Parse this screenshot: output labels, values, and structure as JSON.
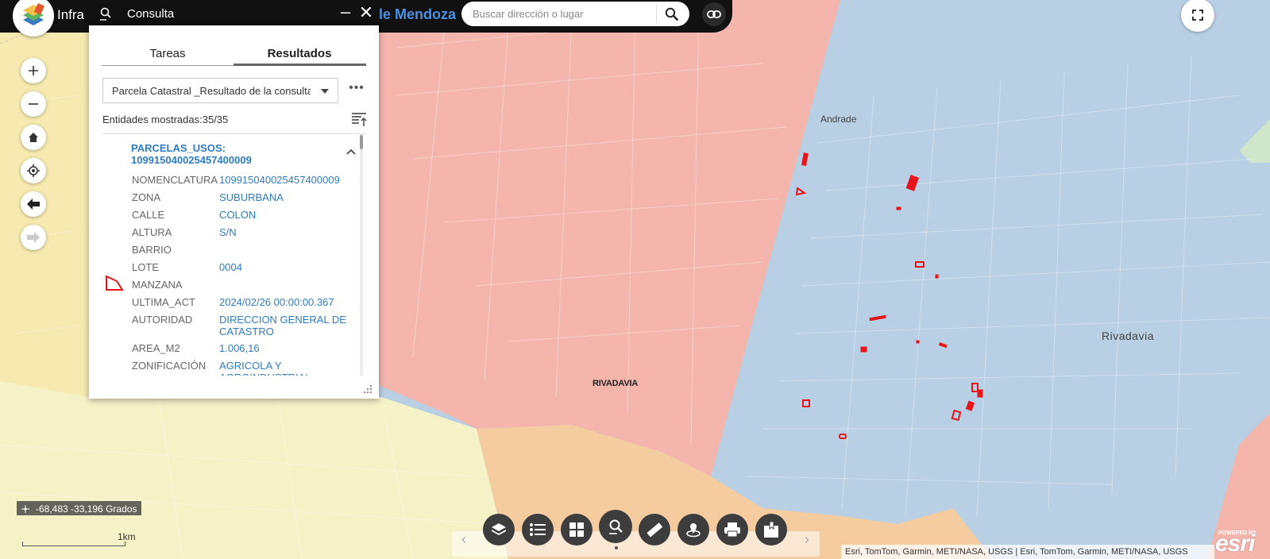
{
  "header": {
    "app_title": "Infra",
    "app_title_right": "le Mendoza",
    "search_placeholder": "Buscar dirección o lugar"
  },
  "panel": {
    "title": "Consulta",
    "tabs": [
      {
        "label": "Tareas",
        "active": false
      },
      {
        "label": "Resultados",
        "active": true
      }
    ],
    "layer_selected": "Parcela Catastral _Resultado de la consulta",
    "count_label": "Entidades mostradas:35/35",
    "result": {
      "title_line1": "PARCELAS_USOS:",
      "title_line2": "109915040025457400009",
      "attributes": [
        {
          "name": "NOMENCLATURA",
          "value": "109915040025457400009"
        },
        {
          "name": "ZONA",
          "value": "SUBURBANA"
        },
        {
          "name": "CALLE",
          "value": "COLON"
        },
        {
          "name": "ALTURA",
          "value": "S/N"
        },
        {
          "name": "BARRIO",
          "value": ""
        },
        {
          "name": "LOTE",
          "value": "0004"
        },
        {
          "name": "MANZANA",
          "value": ""
        },
        {
          "name": "ULTIMA_ACT",
          "value": "2024/02/26 00:00:00.367"
        },
        {
          "name": "AUTORIDAD",
          "value": "DIRECCION GENERAL DE CATASTRO"
        },
        {
          "name": "AREA_M2",
          "value": "1.006,16"
        },
        {
          "name": "ZONIFICACIÓN",
          "value": "AGRICOLA Y AGROINDUSTRIAL"
        }
      ]
    }
  },
  "map": {
    "labels": {
      "andrade": "Andrade",
      "rivadavia_city": "Rivadavia",
      "rivadavia_dept": "RIVADAVIA"
    },
    "coordinates": "-68,483 -33,196 Grados",
    "scale_label": "1km",
    "attribution": "Esri, TomTom, Garmin, METI/NASA, USGS | Esri, TomTom, Garmin, METI/NASA, USGS",
    "esri_logo": "esri",
    "esri_powered": "POWERED BY",
    "colors": {
      "zone_red": "#f4b5ad",
      "zone_blue": "#b8cfe4",
      "zone_yellow": "#f6eab0",
      "zone_cream": "#f5f2c8",
      "zone_orange": "#f5cca0",
      "parcel_red": "#e8141c",
      "link_blue": "#2e7bc4"
    }
  },
  "toolbar": {
    "buttons": [
      {
        "name": "layers",
        "icon": "layers-icon"
      },
      {
        "name": "legend",
        "icon": "list-icon"
      },
      {
        "name": "basemap",
        "icon": "grid-icon"
      },
      {
        "name": "query",
        "icon": "query-icon",
        "active": true
      },
      {
        "name": "measure",
        "icon": "ruler-icon"
      },
      {
        "name": "location",
        "icon": "location-icon"
      },
      {
        "name": "print",
        "icon": "print-icon"
      },
      {
        "name": "bookmark",
        "icon": "bookmark-icon"
      }
    ]
  }
}
